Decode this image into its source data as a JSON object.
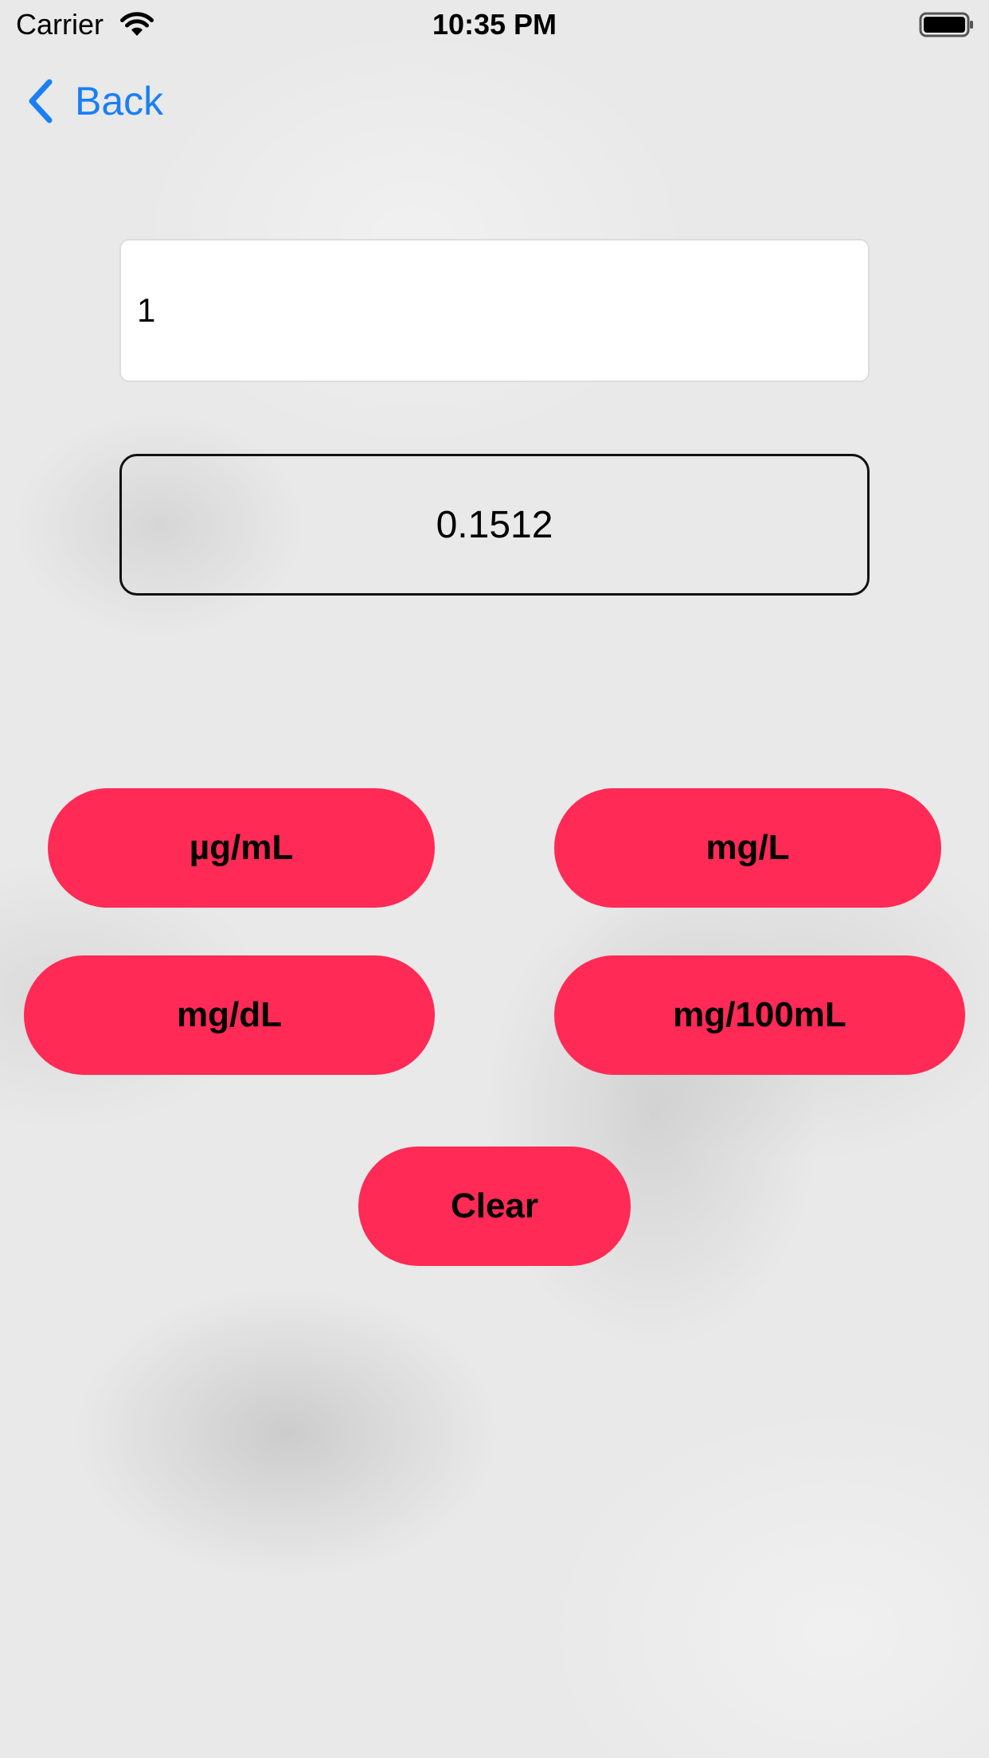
{
  "status_bar": {
    "carrier": "Carrier",
    "time": "10:35 PM",
    "wifi_icon": "wifi-icon",
    "battery_icon": "battery-icon"
  },
  "nav": {
    "back_label": "Back",
    "back_icon": "chevron-left-icon"
  },
  "input": {
    "value": "1",
    "placeholder": ""
  },
  "result": {
    "value": "0.1512"
  },
  "buttons": {
    "ug_ml": "µg/mL",
    "mg_l": "mg/L",
    "mg_dl": "mg/dL",
    "mg_100ml": "mg/100mL",
    "clear": "Clear"
  },
  "colors": {
    "accent": "#ff2a55",
    "link": "#1a7ff5",
    "background": "#e9e9e9"
  }
}
